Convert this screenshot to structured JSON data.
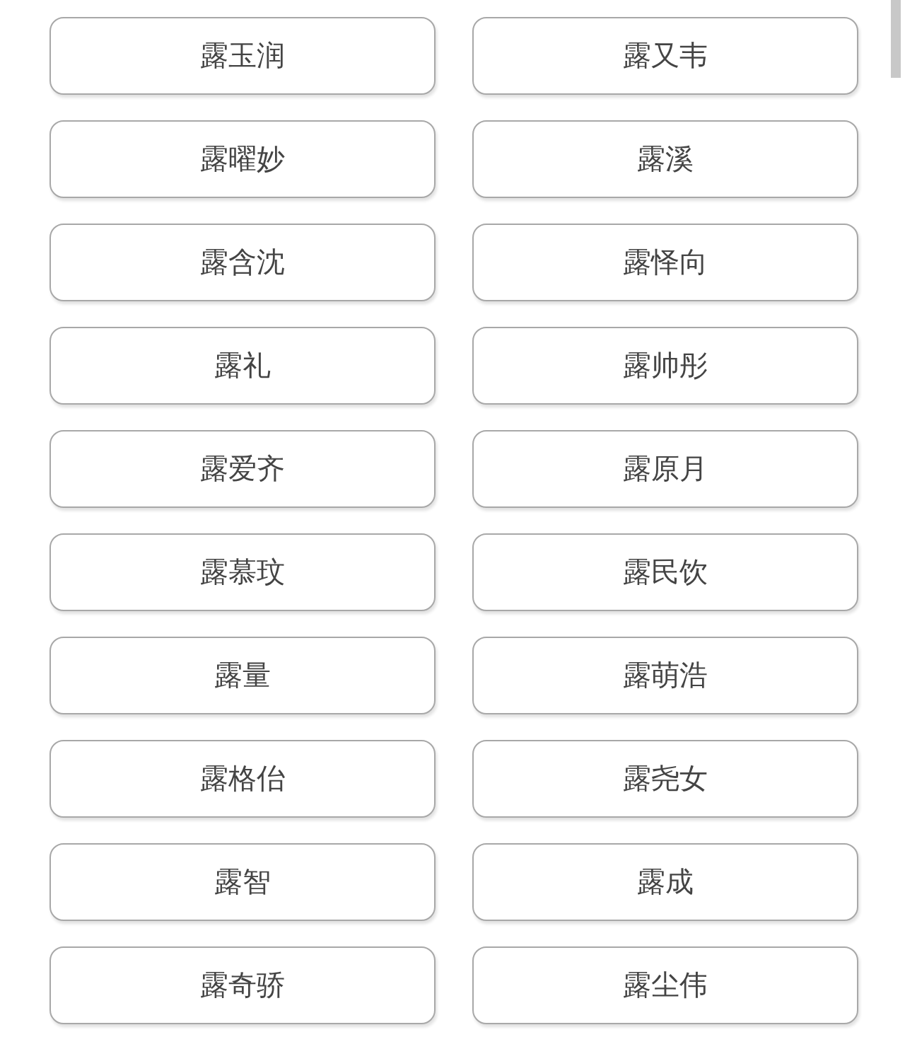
{
  "names": [
    {
      "label": "露玉润"
    },
    {
      "label": "露又韦"
    },
    {
      "label": "露曜妙"
    },
    {
      "label": "露溪"
    },
    {
      "label": "露含沈"
    },
    {
      "label": "露怿向"
    },
    {
      "label": "露礼"
    },
    {
      "label": "露帅彤"
    },
    {
      "label": "露爱齐"
    },
    {
      "label": "露原月"
    },
    {
      "label": "露慕玟"
    },
    {
      "label": "露民饮"
    },
    {
      "label": "露量"
    },
    {
      "label": "露萌浩"
    },
    {
      "label": "露格佁"
    },
    {
      "label": "露尧女"
    },
    {
      "label": "露智"
    },
    {
      "label": "露成"
    },
    {
      "label": "露奇骄"
    },
    {
      "label": "露尘伟"
    }
  ]
}
